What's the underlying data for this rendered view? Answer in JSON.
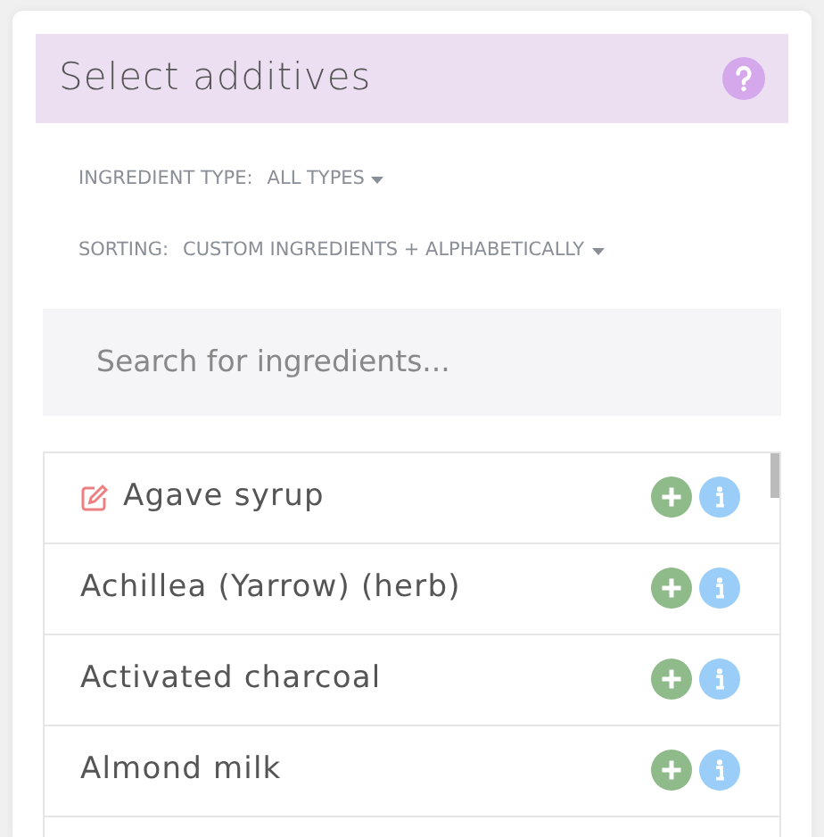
{
  "title": "Select additives",
  "filters": [
    {
      "label": "INGREDIENT TYPE:",
      "value": "ALL TYPES"
    },
    {
      "label": "SORTING:",
      "value": "CUSTOM INGREDIENTS + ALPHABETICALLY"
    }
  ],
  "search": {
    "placeholder": "Search for ingredients..."
  },
  "ingredients": [
    {
      "name": "Agave syrup",
      "custom": true
    },
    {
      "name": "Achillea (Yarrow) (herb)",
      "custom": false
    },
    {
      "name": "Activated charcoal",
      "custom": false
    },
    {
      "name": "Almond milk",
      "custom": false
    }
  ]
}
